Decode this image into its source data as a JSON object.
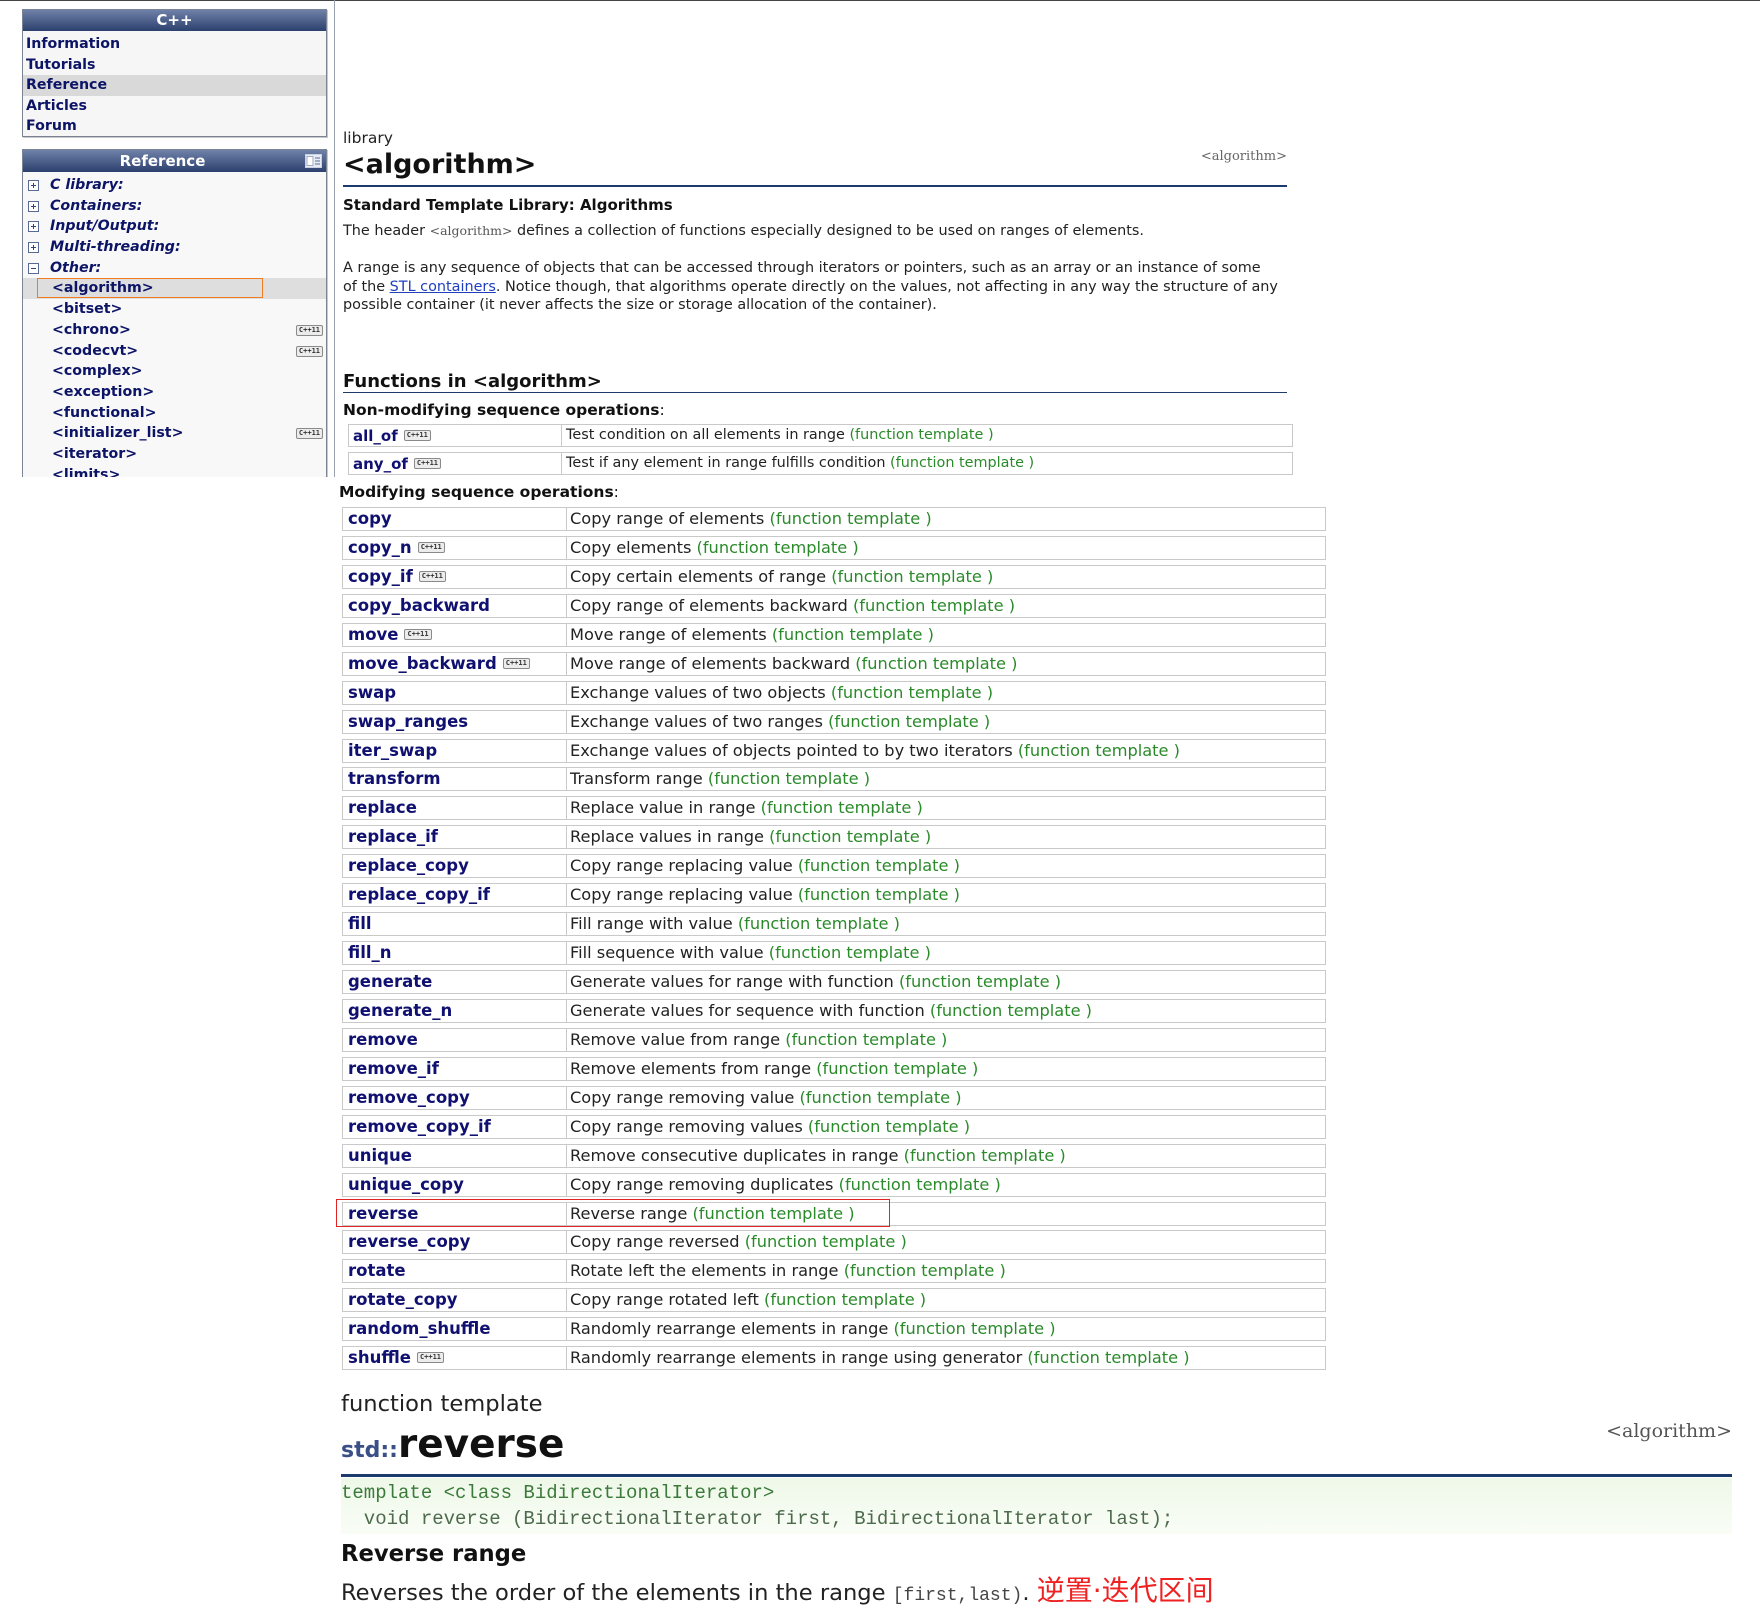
{
  "sidebar": {
    "cpp": {
      "title": "C++",
      "items": [
        {
          "label": "Information"
        },
        {
          "label": "Tutorials"
        },
        {
          "label": "Reference",
          "active": true
        },
        {
          "label": "Articles"
        },
        {
          "label": "Forum"
        }
      ]
    },
    "reference": {
      "title": "Reference",
      "categories": [
        {
          "label": "C library:",
          "expanded": false
        },
        {
          "label": "Containers:",
          "expanded": false
        },
        {
          "label": "Input/Output:",
          "expanded": false
        },
        {
          "label": "Multi-threading:",
          "expanded": false
        },
        {
          "label": "Other:",
          "expanded": true
        }
      ],
      "other_headers": [
        {
          "label": "<algorithm>",
          "selected": true
        },
        {
          "label": "<bitset>"
        },
        {
          "label": "<chrono>",
          "cpp11": true
        },
        {
          "label": "<codecvt>",
          "cpp11": true
        },
        {
          "label": "<complex>"
        },
        {
          "label": "<exception>"
        },
        {
          "label": "<functional>"
        },
        {
          "label": "<initializer_list>",
          "cpp11": true
        },
        {
          "label": "<iterator>"
        },
        {
          "label": "<limits>"
        }
      ]
    }
  },
  "cpp11_badge": "C++11",
  "library_page": {
    "kind": "library",
    "title": "<algorithm>",
    "file": "<algorithm>",
    "subtitle": "Standard Template Library: Algorithms",
    "header_sentence": {
      "before": "The header ",
      "code": "<algorithm>",
      "after": " defines a collection of functions especially designed to be used on ranges of elements."
    },
    "range_paragraph": {
      "before": "A range is any sequence of objects that can be accessed through iterators or pointers, such as an array or an instance of some of the ",
      "link": "STL containers",
      "after": ". Notice though, that algorithms operate directly on the values, not affecting in any way the structure of any possible container (it never affects the size or storage allocation of the container)."
    },
    "functions_heading": "Functions in <algorithm>",
    "kind_label": "(function template )",
    "non_modifying": {
      "title": "Non-modifying sequence operations",
      "colon": ":",
      "rows": [
        {
          "name": "all_of",
          "desc": "Test condition on all elements in range",
          "cpp11": true
        },
        {
          "name": "any_of",
          "desc": "Test if any element in range fulfills condition",
          "cpp11": true
        }
      ]
    },
    "modifying": {
      "title": "Modifying sequence operations",
      "colon": ":",
      "rows": [
        {
          "name": "copy",
          "desc": "Copy range of elements"
        },
        {
          "name": "copy_n",
          "desc": "Copy elements",
          "cpp11": true
        },
        {
          "name": "copy_if",
          "desc": "Copy certain elements of range",
          "cpp11": true
        },
        {
          "name": "copy_backward",
          "desc": "Copy range of elements backward"
        },
        {
          "name": "move",
          "desc": "Move range of elements",
          "cpp11": true
        },
        {
          "name": "move_backward",
          "desc": "Move range of elements backward",
          "cpp11": true
        },
        {
          "name": "swap",
          "desc": "Exchange values of two objects"
        },
        {
          "name": "swap_ranges",
          "desc": "Exchange values of two ranges"
        },
        {
          "name": "iter_swap",
          "desc": "Exchange values of objects pointed to by two iterators"
        },
        {
          "name": "transform",
          "desc": "Transform range"
        },
        {
          "name": "replace",
          "desc": "Replace value in range"
        },
        {
          "name": "replace_if",
          "desc": "Replace values in range"
        },
        {
          "name": "replace_copy",
          "desc": "Copy range replacing value"
        },
        {
          "name": "replace_copy_if",
          "desc": "Copy range replacing value"
        },
        {
          "name": "fill",
          "desc": "Fill range with value"
        },
        {
          "name": "fill_n",
          "desc": "Fill sequence with value"
        },
        {
          "name": "generate",
          "desc": "Generate values for range with function"
        },
        {
          "name": "generate_n",
          "desc": "Generate values for sequence with function"
        },
        {
          "name": "remove",
          "desc": "Remove value from range"
        },
        {
          "name": "remove_if",
          "desc": "Remove elements from range"
        },
        {
          "name": "remove_copy",
          "desc": "Copy range removing value"
        },
        {
          "name": "remove_copy_if",
          "desc": "Copy range removing values"
        },
        {
          "name": "unique",
          "desc": "Remove consecutive duplicates in range"
        },
        {
          "name": "unique_copy",
          "desc": "Copy range removing duplicates"
        },
        {
          "name": "reverse",
          "desc": "Reverse range"
        },
        {
          "name": "reverse_copy",
          "desc": "Copy range reversed"
        },
        {
          "name": "rotate",
          "desc": "Rotate left the elements in range"
        },
        {
          "name": "rotate_copy",
          "desc": "Copy range rotated left"
        },
        {
          "name": "random_shuffle",
          "desc": "Randomly rearrange elements in range"
        },
        {
          "name": "shuffle",
          "desc": "Randomly rearrange elements in range using generator",
          "cpp11": true
        }
      ]
    }
  },
  "detail": {
    "kind": "function template",
    "namespace": "std::",
    "name": "reverse",
    "file": "<algorithm>",
    "prototype": [
      "template <class BidirectionalIterator>",
      "  void reverse (BidirectionalIterator first, BidirectionalIterator last);"
    ],
    "title": "Reverse range",
    "description": {
      "before": "Reverses the order of the elements in the range ",
      "range": "[first,last)",
      "after": ". ",
      "annotation": "逆置·迭代区间"
    }
  },
  "colors": {
    "header_navy": "#2c406e",
    "link_navy": "#101070",
    "kind_green": "#2a8a2a",
    "rule_blue": "#1c3a6c",
    "annotation_orange": "#f07c22",
    "annotation_red": "#e02424",
    "annotation_text_red": "#ee2222"
  }
}
